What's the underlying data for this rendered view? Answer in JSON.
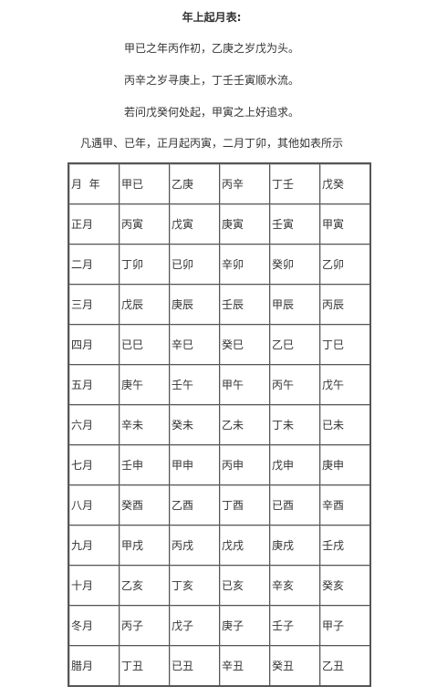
{
  "title": "年上起月表:",
  "lines": [
    "甲已之年丙作初，乙庚之岁戊为头。",
    "丙辛之岁寻庚上，丁壬壬寅顺水流。",
    "若问戊癸何处起，甲寅之上好追求。",
    "凡遇甲、已年，正月起丙寅，二月丁卯，其他如表所示"
  ],
  "table": {
    "header": [
      "月  年",
      "甲已",
      "乙庚",
      "丙辛",
      "丁壬",
      "戊癸"
    ],
    "rows": [
      [
        "正月",
        "丙寅",
        "戊寅",
        "庚寅",
        "壬寅",
        "甲寅"
      ],
      [
        "二月",
        "丁卯",
        "已卯",
        "辛卯",
        "癸卯",
        "乙卯"
      ],
      [
        "三月",
        "戊辰",
        "庚辰",
        "壬辰",
        "甲辰",
        "丙辰"
      ],
      [
        "四月",
        "已巳",
        "辛巳",
        "癸巳",
        "乙巳",
        "丁巳"
      ],
      [
        "五月",
        "庚午",
        "壬午",
        "甲午",
        "丙午",
        "戊午"
      ],
      [
        "六月",
        "辛未",
        "癸未",
        "乙未",
        "丁未",
        "已未"
      ],
      [
        "七月",
        "壬申",
        "甲申",
        "丙申",
        "戊申",
        "庚申"
      ],
      [
        "八月",
        "癸酉",
        "乙酉",
        "丁酉",
        "已酉",
        "辛酉"
      ],
      [
        "九月",
        "甲戌",
        "丙戌",
        "戊戌",
        "庚戌",
        "壬戌"
      ],
      [
        "十月",
        "乙亥",
        "丁亥",
        "已亥",
        "辛亥",
        "癸亥"
      ],
      [
        "冬月",
        "丙子",
        "戊子",
        "庚子",
        "壬子",
        "甲子"
      ],
      [
        "腊月",
        "丁丑",
        "已丑",
        "辛丑",
        "癸丑",
        "乙丑"
      ]
    ]
  }
}
